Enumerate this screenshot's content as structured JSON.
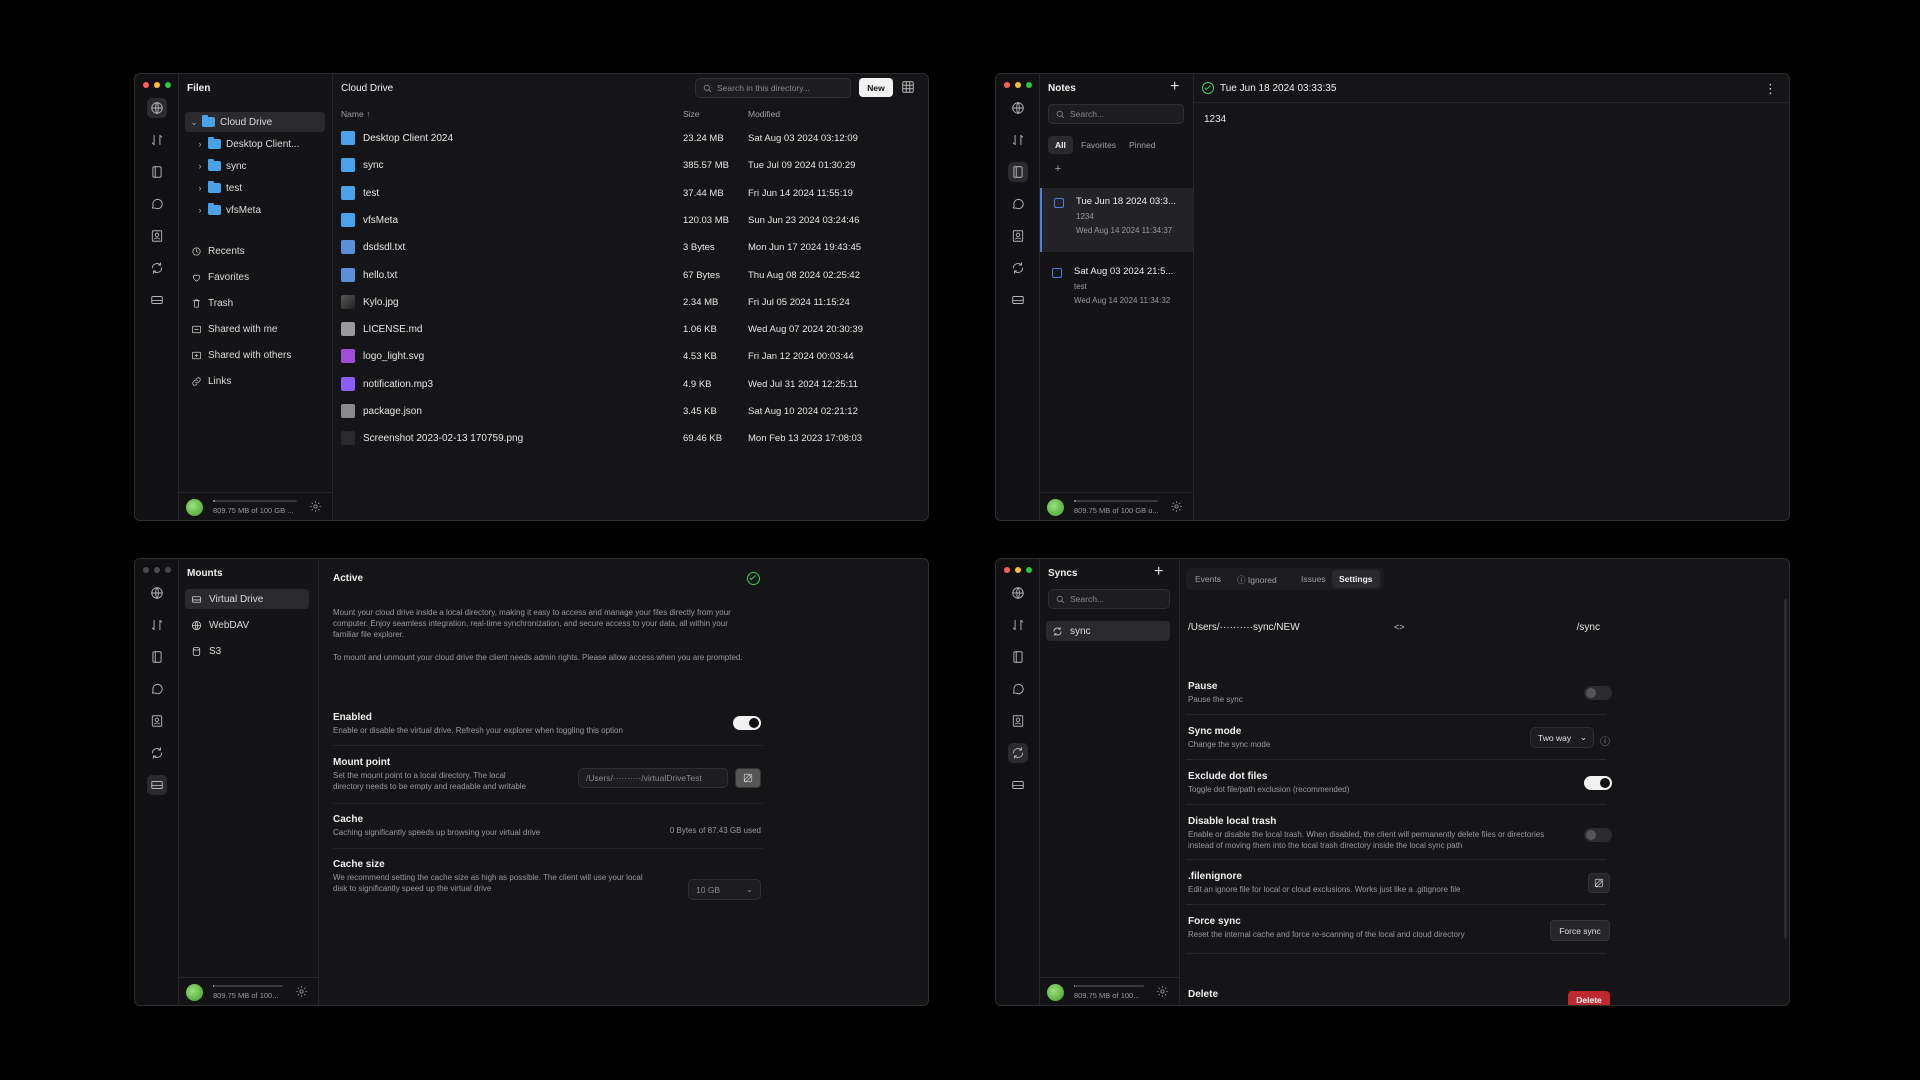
{
  "rail_icons": [
    "globe-icon",
    "transfer-icon",
    "notes-icon",
    "chat-icon",
    "contacts-icon",
    "sync-icon",
    "drive-icon"
  ],
  "storage": {
    "label": "809.75 MB of 100 GB ...",
    "label_short": "809.75 MB of 100 GB u...",
    "label_mounts": "809.75 MB of 100...",
    "label_syncs": "809.75 MB of 100...",
    "used_fraction": 0.008
  },
  "drive": {
    "app_title": "Filen",
    "tree": [
      {
        "label": "Cloud Drive",
        "selected": true,
        "expanded": true,
        "depth": 0
      },
      {
        "label": "Desktop Client...",
        "depth": 1
      },
      {
        "label": "sync",
        "depth": 1
      },
      {
        "label": "test",
        "depth": 1
      },
      {
        "label": "vfsMeta",
        "depth": 1
      }
    ],
    "nav": [
      "Recents",
      "Favorites",
      "Trash",
      "Shared with me",
      "Shared with others",
      "Links"
    ],
    "header_title": "Cloud Drive",
    "search_placeholder": "Search in this directory...",
    "new_label": "New",
    "columns": {
      "name": "Name",
      "sort_arrow": "↑",
      "size": "Size",
      "modified": "Modified"
    },
    "files": [
      {
        "name": "Desktop Client 2024",
        "size": "23.24 MB",
        "modified": "Sat Aug 03 2024 03:12:09",
        "icon": "folder"
      },
      {
        "name": "sync",
        "size": "385.57 MB",
        "modified": "Tue Jul 09 2024 01:30:29",
        "icon": "folder"
      },
      {
        "name": "test",
        "size": "37.44 MB",
        "modified": "Fri Jun 14 2024 11:55:19",
        "icon": "folder"
      },
      {
        "name": "vfsMeta",
        "size": "120.03 MB",
        "modified": "Sun Jun 23 2024 03:24:46",
        "icon": "folder"
      },
      {
        "name": "dsdsdl.txt",
        "size": "3 Bytes",
        "modified": "Mon Jun 17 2024 19:43:45",
        "icon": "txt"
      },
      {
        "name": "hello.txt",
        "size": "67 Bytes",
        "modified": "Thu Aug 08 2024 02:25:42",
        "icon": "txt"
      },
      {
        "name": "Kylo.jpg",
        "size": "2.34 MB",
        "modified": "Fri Jul 05 2024 11:15:24",
        "icon": "img"
      },
      {
        "name": "LICENSE.md",
        "size": "1.06 KB",
        "modified": "Wed Aug 07 2024 20:30:39",
        "icon": "md"
      },
      {
        "name": "logo_light.svg",
        "size": "4.53 KB",
        "modified": "Fri Jan 12 2024 00:03:44",
        "icon": "svg"
      },
      {
        "name": "notification.mp3",
        "size": "4.9 KB",
        "modified": "Wed Jul 31 2024 12:25:11",
        "icon": "mp3"
      },
      {
        "name": "package.json",
        "size": "3.45 KB",
        "modified": "Sat Aug 10 2024 02:21:12",
        "icon": "json"
      },
      {
        "name": "Screenshot 2023-02-13 170759.png",
        "size": "69.46 KB",
        "modified": "Mon Feb 13 2023 17:08:03",
        "icon": "png"
      }
    ]
  },
  "notes": {
    "app_title": "Notes",
    "add": "+",
    "search_placeholder": "Search...",
    "tabs": [
      "All",
      "Favorites",
      "Pinned"
    ],
    "tag_add": "+",
    "list": [
      {
        "title": "Tue Jun 18 2024 03:3...",
        "preview": "1234",
        "date": "Wed Aug 14 2024 11:34:37",
        "selected": true
      },
      {
        "title": "Sat Aug 03 2024 21:5...",
        "preview": "test",
        "date": "Wed Aug 14 2024 11:34:32",
        "selected": false
      }
    ],
    "editor_title": "Tue Jun 18 2024 03:33:35",
    "editor_body": "1234",
    "more": "⋮"
  },
  "mounts": {
    "app_title": "Mounts",
    "items": [
      "Virtual Drive",
      "WebDAV",
      "S3"
    ],
    "status": "Active",
    "intro": "Mount your cloud drive inside a local directory, making it easy to access and manage your files directly from your computer. Enjoy seamless integration, real-time synchronization, and secure access to your data, all within your familiar file explorer.",
    "admin_note": "To mount and unmount your cloud drive the client needs admin rights. Please allow access when you are prompted.",
    "enabled_title": "Enabled",
    "enabled_desc": "Enable or disable the virtual drive. Refresh your explorer when toggling this option",
    "mount_title": "Mount point",
    "mount_desc": "Set the mount point to a local directory. The local directory needs to be empty and readable and writable",
    "mount_value": "/Users/··········/virtualDriveTest",
    "cache_title": "Cache",
    "cache_desc": "Caching significantly speeds up browsing your virtual drive",
    "cache_value": "0 Bytes of 87.43 GB used",
    "cache_size_title": "Cache size",
    "cache_size_desc": "We recommend setting the cache size as high as possible. The client will use your local disk to significantly speed up the virtual drive",
    "cache_size_value": "10 GB"
  },
  "syncs": {
    "app_title": "Syncs",
    "add": "+",
    "search_placeholder": "Search...",
    "items": [
      "sync"
    ],
    "tabs": [
      "Events",
      "Ignored",
      "Issues",
      "Settings"
    ],
    "local_path": "/Users/··········sync/NEW",
    "swap": "<>",
    "remote_path": "/sync",
    "pause_title": "Pause",
    "pause_desc": "Pause the sync",
    "mode_title": "Sync mode",
    "mode_desc": "Change the sync mode",
    "mode_value": "Two way",
    "dot_title": "Exclude dot files",
    "dot_desc": "Toggle dot file/path exclusion (recommended)",
    "trash_title": "Disable local trash",
    "trash_desc": "Enable or disable the local trash. When disabled, the client will permanently delete files or directories instead of moving them into the local trash directory inside the local sync path",
    "ignore_title": ".filenignore",
    "ignore_desc": "Edit an ignore file for local or cloud exclusions. Works just like a .gitignore file",
    "force_title": "Force sync",
    "force_desc": "Reset the internal cache and force re-scanning of the local and cloud directory",
    "force_btn": "Force sync",
    "delete_title": "Delete",
    "delete_btn": "Delete"
  },
  "colors": {
    "accent_folder": "#4aa3e8",
    "danger": "#c0282d",
    "success": "#3ecf5a"
  }
}
